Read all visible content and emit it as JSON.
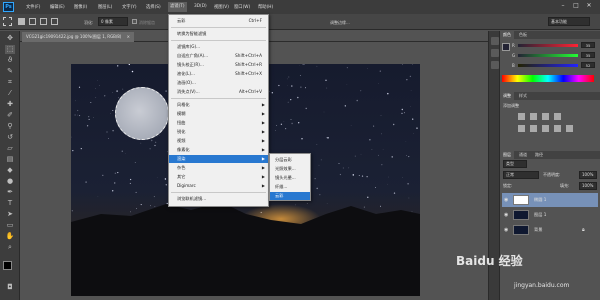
{
  "app": {
    "logo": "Ps"
  },
  "menubar": {
    "items": [
      "文件(F)",
      "编辑(E)",
      "图像(I)",
      "图层(L)",
      "文字(Y)",
      "选择(S)",
      "滤镜(T)",
      "3D(D)",
      "视图(V)",
      "窗口(W)",
      "帮助(H)"
    ],
    "active": "滤镜(T)",
    "window_controls": [
      "–",
      "□",
      "✕"
    ]
  },
  "options_bar": {
    "feather_label": "羽化:",
    "feather_value": "0 像素",
    "antialias_label": "消除锯齿",
    "refine_edge_label": "调整边缘...",
    "workspace": "基本功能"
  },
  "document": {
    "tab_title": "VCG21gic19091422.jpg @ 100%(图层 1, RGB/8)",
    "tab_close": "×"
  },
  "filter_menu": {
    "items": [
      {
        "label": "云彩",
        "shortcut": "Ctrl+F"
      },
      {
        "label": "转换为智能滤镜",
        "shortcut": ""
      },
      {
        "label": "滤镜库(G)...",
        "shortcut": ""
      },
      {
        "label": "自适应广角(A)...",
        "shortcut": "Shift+Ctrl+A"
      },
      {
        "label": "镜头校正(R)...",
        "shortcut": "Shift+Ctrl+R"
      },
      {
        "label": "液化(L)...",
        "shortcut": "Shift+Ctrl+X"
      },
      {
        "label": "油画(O)...",
        "shortcut": ""
      },
      {
        "label": "消失点(V)...",
        "shortcut": "Alt+Ctrl+V"
      },
      {
        "label": "风格化",
        "submenu": true
      },
      {
        "label": "模糊",
        "submenu": true
      },
      {
        "label": "扭曲",
        "submenu": true
      },
      {
        "label": "锐化",
        "submenu": true
      },
      {
        "label": "视频",
        "submenu": true
      },
      {
        "label": "像素化",
        "submenu": true
      },
      {
        "label": "渲染",
        "submenu": true,
        "highlighted": true
      },
      {
        "label": "杂色",
        "submenu": true
      },
      {
        "label": "其它",
        "submenu": true
      },
      {
        "label": "Digimarc",
        "submenu": true
      },
      {
        "label": "浏览联机滤镜...",
        "shortcut": ""
      }
    ]
  },
  "render_submenu": {
    "items": [
      "分层云彩",
      "光照效果...",
      "镜头光晕...",
      "纤维...",
      "云彩"
    ],
    "highlighted": "云彩"
  },
  "color_panel": {
    "tabs": [
      "颜色",
      "色板"
    ],
    "channels": [
      {
        "label": "R",
        "value": "35"
      },
      {
        "label": "G",
        "value": "35"
      },
      {
        "label": "B",
        "value": "52"
      }
    ]
  },
  "adjust_panel": {
    "tabs": [
      "调整",
      "样式"
    ],
    "title": "添加调整"
  },
  "layers_panel": {
    "tabs": [
      "图层",
      "通道",
      "路径"
    ],
    "kind_label": "类型",
    "blend_mode": "正常",
    "opacity_label": "不透明度:",
    "opacity_value": "100%",
    "lock_label": "锁定:",
    "fill_label": "填充:",
    "fill_value": "100%",
    "layers": [
      {
        "name": "椭圆 1",
        "selected": true
      },
      {
        "name": "图层 1",
        "selected": false
      },
      {
        "name": "背景",
        "selected": false
      }
    ]
  },
  "watermark": {
    "brand": "Baidu 经验",
    "url": "jingyan.baidu.com"
  },
  "colors": {
    "menu_highlight": "#2878d0",
    "ps_blue": "#31a8ff"
  }
}
